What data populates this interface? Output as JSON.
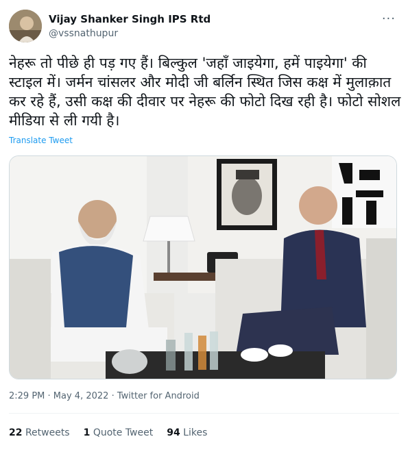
{
  "author": {
    "name": "Vijay Shanker Singh IPS Rtd",
    "handle": "@vssnathupur"
  },
  "more_icon": "ellipsis-icon",
  "tweet": {
    "text": "नेहरू तो पीछे ही पड़ गए हैं। बिल्कुल 'जहाँ जाइयेगा, हमें पाइयेगा' की स्टाइल में। जर्मन चांसलर और मोदी जी बर्लिन स्थित जिस कक्ष में मुलाक़ात कर रहे हैं, उसी कक्ष की दीवार पर नेहरू की फोटो दिख रही है। फोटो सोशल मीडिया से ली गयी है।",
    "translate_label": "Translate Tweet"
  },
  "meta": {
    "time": "2:29 PM",
    "date": "May 4, 2022",
    "source": "Twitter for Android"
  },
  "stats": {
    "retweets_count": "22",
    "retweets_label": "Retweets",
    "quotes_count": "1",
    "quotes_label": "Quote Tweet",
    "likes_count": "94",
    "likes_label": "Likes"
  }
}
